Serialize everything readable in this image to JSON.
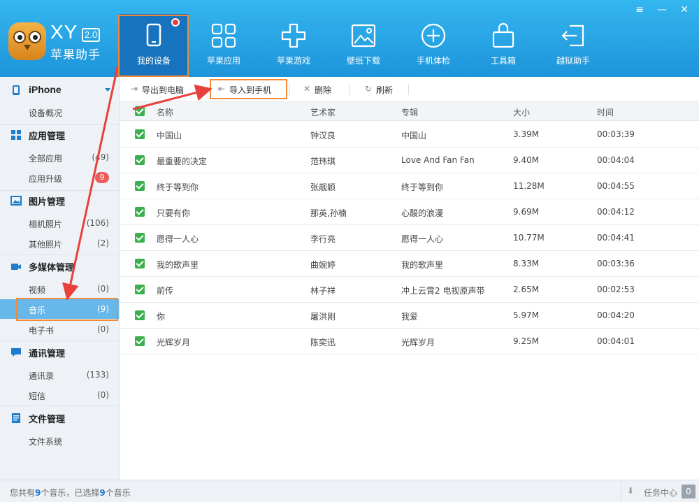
{
  "app": {
    "logo_name": "XY",
    "logo_version": "2.0",
    "logo_subtitle": "苹果助手"
  },
  "nav": [
    {
      "label": "我的设备",
      "icon": "tablet-icon"
    },
    {
      "label": "苹果应用",
      "icon": "apps-grid-icon"
    },
    {
      "label": "苹果游戏",
      "icon": "gamepad-icon"
    },
    {
      "label": "壁纸下载",
      "icon": "picture-icon"
    },
    {
      "label": "手机体检",
      "icon": "plus-circle-icon"
    },
    {
      "label": "工具箱",
      "icon": "toolbox-icon"
    },
    {
      "label": "越狱助手",
      "icon": "exit-icon"
    }
  ],
  "window_controls": [
    "≡",
    "—",
    "✕"
  ],
  "sidebar": {
    "device": {
      "name": "iPhone",
      "items": [
        {
          "label": "设备概况"
        }
      ]
    },
    "groups": [
      {
        "title": "应用管理",
        "items": [
          {
            "label": "全部应用",
            "count": "(49)"
          },
          {
            "label": "应用升级",
            "badge": "9"
          }
        ]
      },
      {
        "title": "图片管理",
        "items": [
          {
            "label": "相机照片",
            "count": "(106)"
          },
          {
            "label": "其他照片",
            "count": "(2)"
          }
        ]
      },
      {
        "title": "多媒体管理",
        "items": [
          {
            "label": "视频",
            "count": "(0)"
          },
          {
            "label": "音乐",
            "count": "(9)"
          },
          {
            "label": "电子书",
            "count": "(0)"
          }
        ]
      },
      {
        "title": "通讯管理",
        "items": [
          {
            "label": "通讯录",
            "count": "(133)"
          },
          {
            "label": "短信",
            "count": "(0)"
          }
        ]
      },
      {
        "title": "文件管理",
        "items": [
          {
            "label": "文件系统"
          }
        ]
      }
    ]
  },
  "toolbar": {
    "export": "导出到电脑",
    "import": "导入到手机",
    "delete": "删除",
    "refresh": "刷新"
  },
  "table": {
    "headers": [
      "名称",
      "艺术家",
      "专辑",
      "大小",
      "时间"
    ],
    "rows": [
      [
        "中国山",
        "钟汉良",
        "中国山",
        "3.39M",
        "00:03:39"
      ],
      [
        "最重要的决定",
        "范玮琪",
        "Love And Fan Fan",
        "9.40M",
        "00:04:04"
      ],
      [
        "终于等到你",
        "张靓颖",
        "终于等到你",
        "11.28M",
        "00:04:55"
      ],
      [
        "只要有你",
        "那英,孙楠",
        "心酸的浪漫",
        "9.69M",
        "00:04:12"
      ],
      [
        "愿得一人心",
        "李行亮",
        "愿得一人心",
        "10.77M",
        "00:04:41"
      ],
      [
        "我的歌声里",
        "曲婉婷",
        "我的歌声里",
        "8.33M",
        "00:03:36"
      ],
      [
        "前传",
        "林子祥",
        "冲上云霄2 电视原声带",
        "2.65M",
        "00:02:53"
      ],
      [
        "你",
        "屠洪刚",
        "我爱",
        "5.97M",
        "00:04:20"
      ],
      [
        "光辉岁月",
        "陈奕迅",
        "光辉岁月",
        "9.25M",
        "00:04:01"
      ]
    ]
  },
  "status": {
    "prefix": "您共有",
    "total": "9",
    "middle": "个音乐，已选择",
    "selected": "9",
    "suffix": "个音乐",
    "task_label": "任务中心",
    "task_count": "0"
  },
  "colors": {
    "header_top": "#34b6ef",
    "header_bottom": "#1e94da",
    "active_nav": "#1873be",
    "highlight_box": "#f28a3a",
    "annotation_arrow": "#e8413c",
    "checkbox": "#3bb14d"
  }
}
